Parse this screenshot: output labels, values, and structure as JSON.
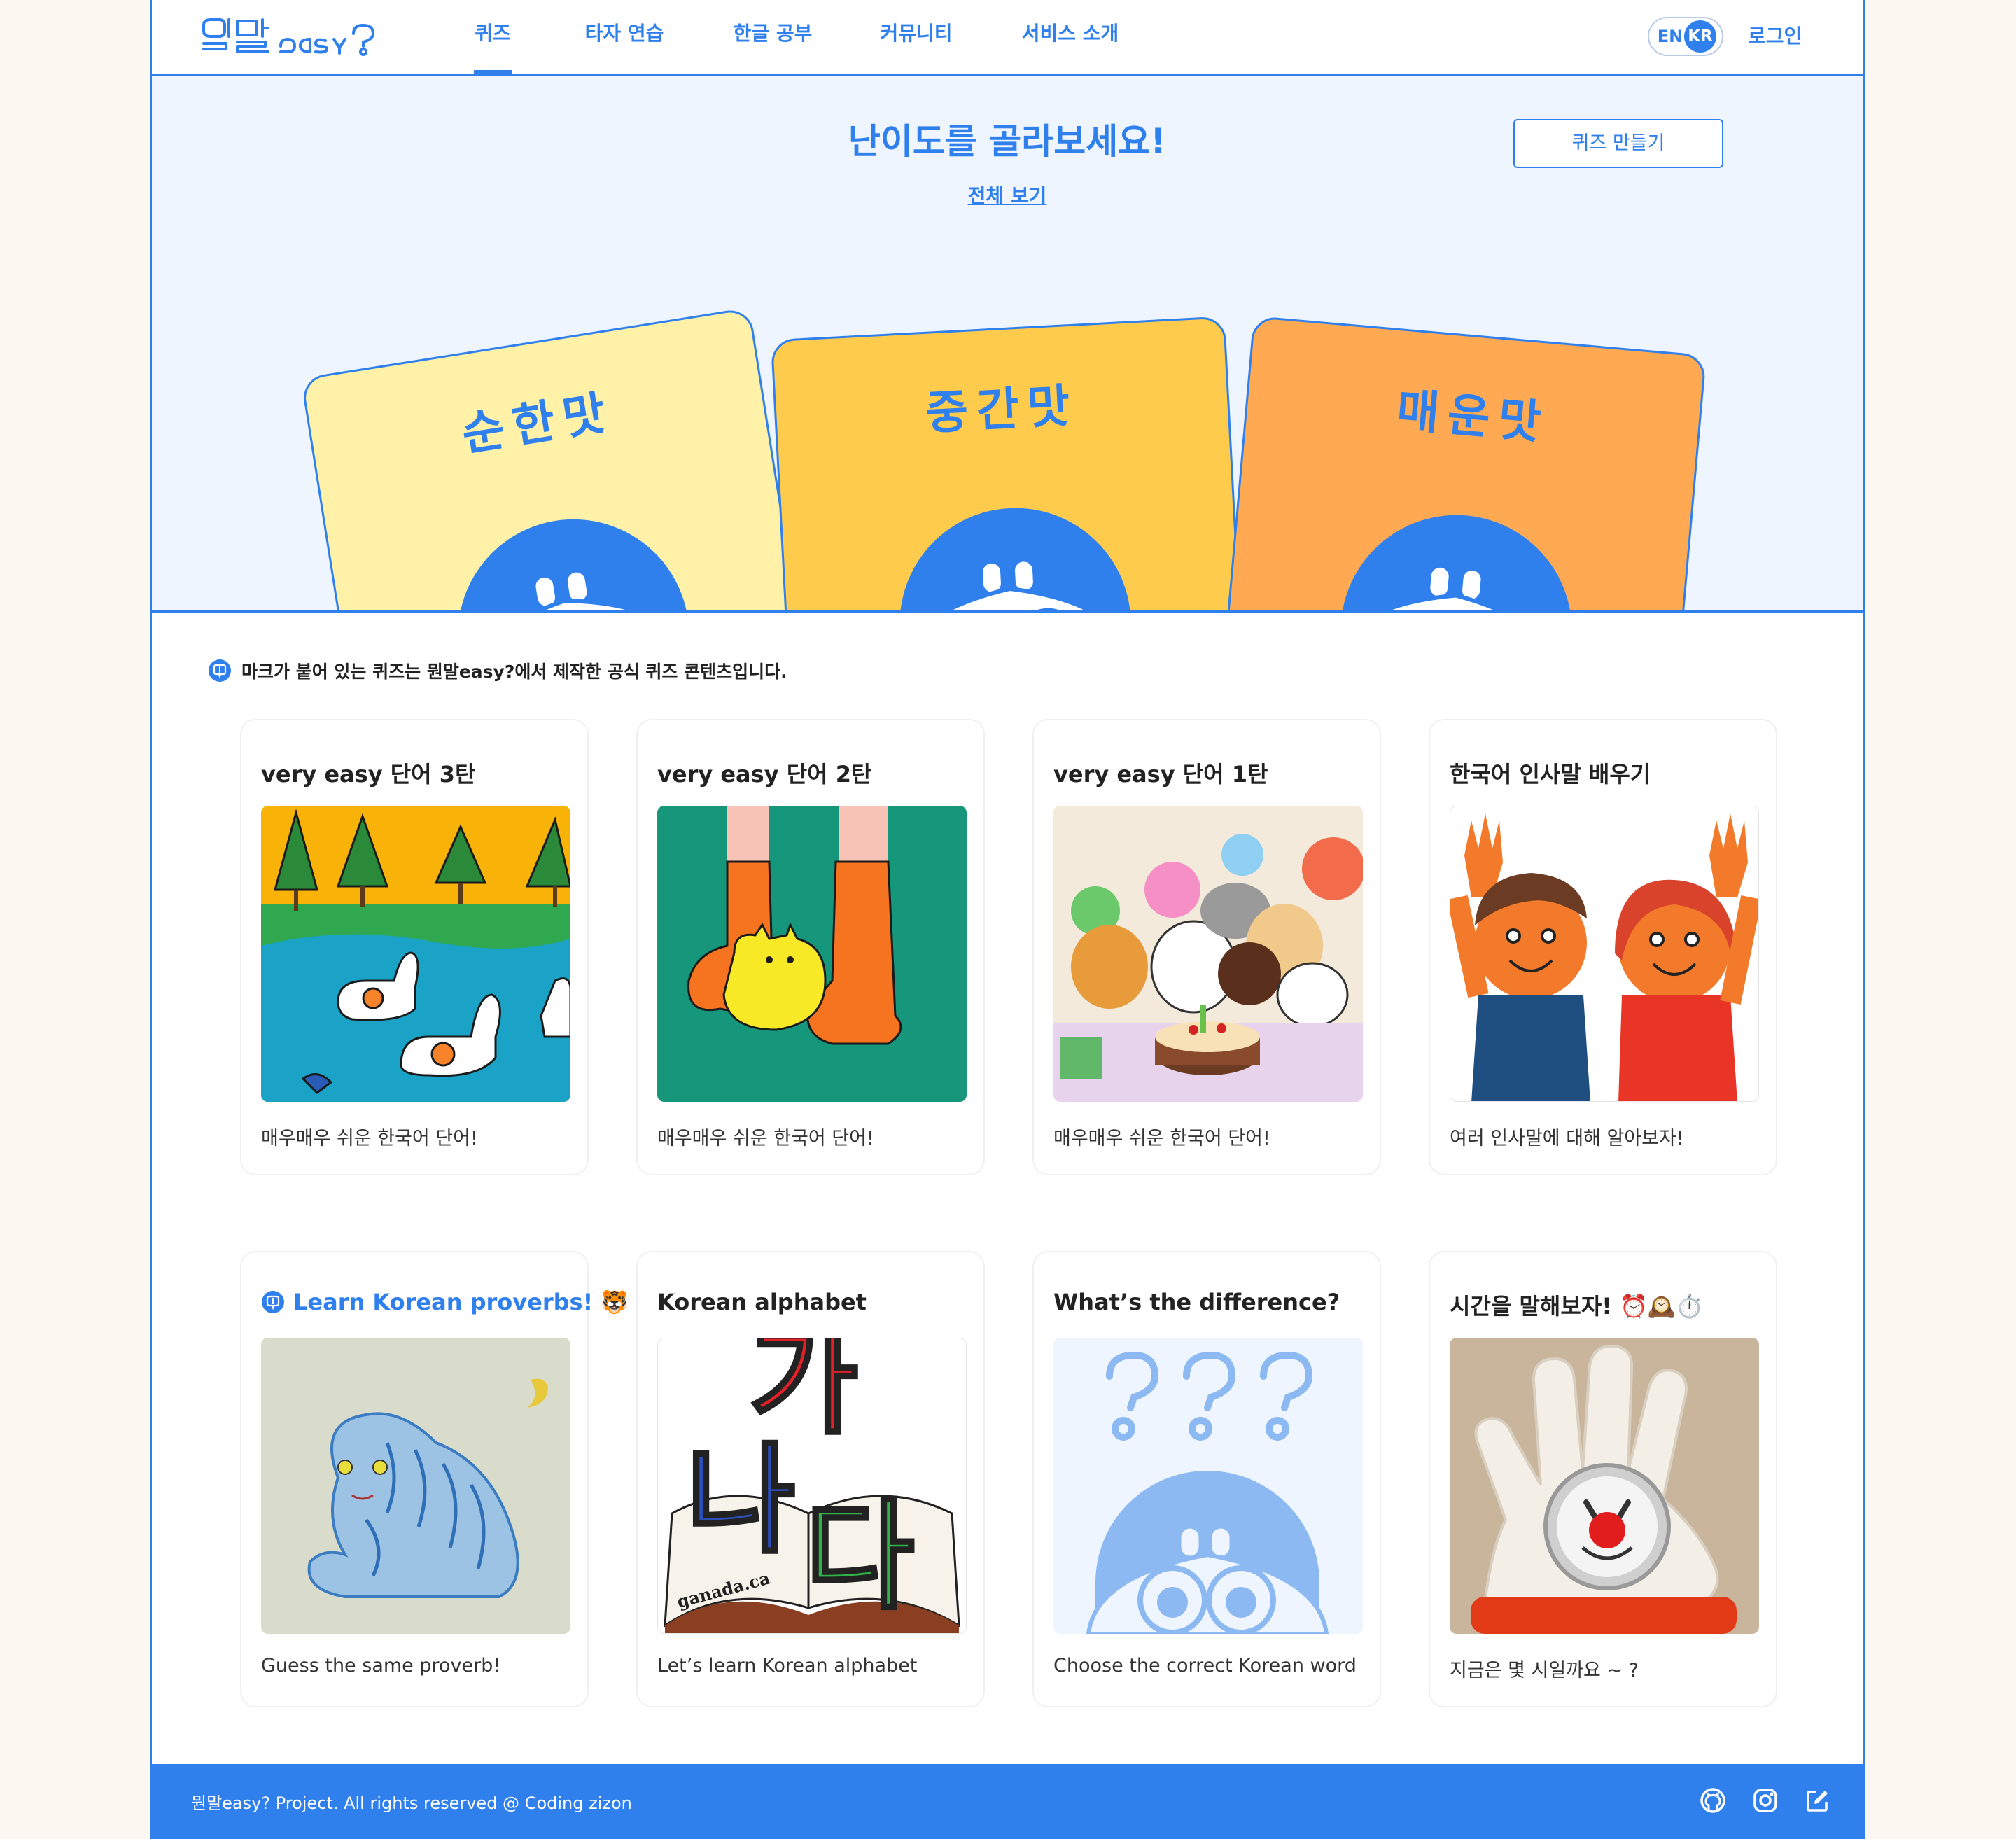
{
  "header": {
    "nav": [
      {
        "label": "퀴즈",
        "active": true
      },
      {
        "label": "타자 연습",
        "active": false
      },
      {
        "label": "한글 공부",
        "active": false
      },
      {
        "label": "커뮤니티",
        "active": false
      },
      {
        "label": "서비스 소개",
        "active": false
      }
    ],
    "lang_en": "EN",
    "lang_kr": "KR",
    "login": "로그인"
  },
  "hero": {
    "title": "난이도를 골라보세요!",
    "view_all": "전체 보기",
    "make_quiz": "퀴즈 만들기",
    "levels": [
      {
        "label": "순한맛",
        "color": "#fff2a8"
      },
      {
        "label": "중간맛",
        "color": "#ffcb4d"
      },
      {
        "label": "매운맛",
        "color": "#ffaa52"
      }
    ]
  },
  "notice": "마크가 붙어 있는 퀴즈는 뭔말easy?에서 제작한 공식 퀴즈 콘텐츠입니다.",
  "quizzes": [
    {
      "title": "very easy 단어 3탄",
      "desc": "매우매우 쉬운 한국어 단어!",
      "official": false
    },
    {
      "title": "very easy 단어 2탄",
      "desc": "매우매우 쉬운 한국어 단어!",
      "official": false
    },
    {
      "title": "very easy 단어 1탄",
      "desc": "매우매우 쉬운 한국어 단어!",
      "official": false
    },
    {
      "title": "한국어 인사말 배우기",
      "desc": "여러 인사말에 대해 알아보자!",
      "official": false
    },
    {
      "title": "Learn Korean proverbs! 🐯",
      "desc": "Guess the same proverb!",
      "official": true
    },
    {
      "title": "Korean alphabet",
      "desc": "Let’s learn Korean alphabet",
      "official": false
    },
    {
      "title": "What’s the difference?",
      "desc": "Choose the correct Korean word",
      "official": false
    },
    {
      "title": "시간을 말해보자! ⏰🕰️⏱️",
      "desc": "지금은 몇 시일까요 ~ ?",
      "official": false
    }
  ],
  "alphabet_image": {
    "letters": [
      "가",
      "나",
      "다"
    ],
    "book_text": "ganada.ca"
  },
  "footer": {
    "text": "뭔말easy? Project. All rights reserved @ Coding zizon",
    "icons": [
      "github-icon",
      "instagram-icon",
      "edit-icon"
    ]
  },
  "colors": {
    "accent": "#2f80ed",
    "hero_bg": "#eef5ff",
    "page_bg": "#fcf7f1"
  }
}
